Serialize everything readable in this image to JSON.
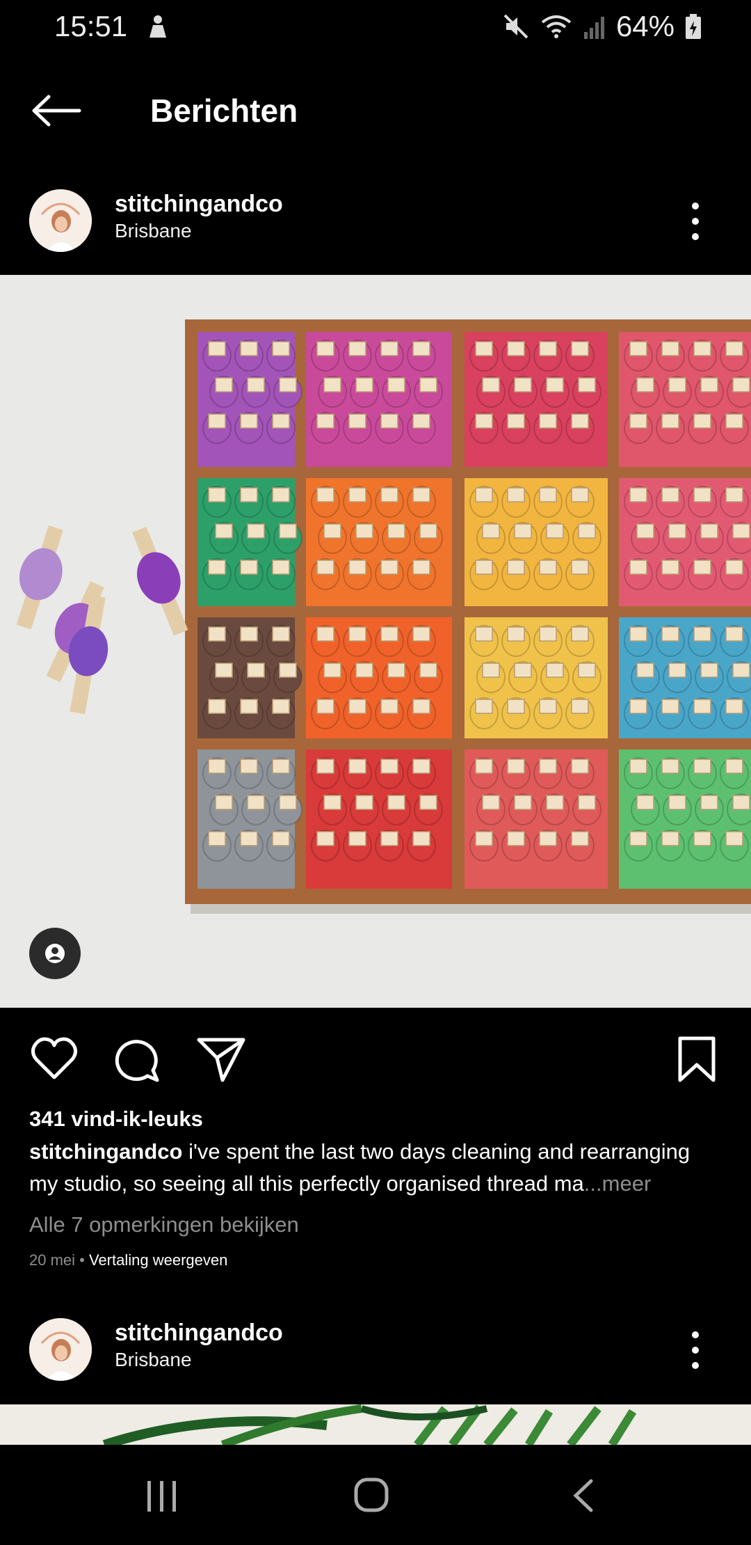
{
  "status_bar": {
    "time": "15:51",
    "battery": "64%"
  },
  "header": {
    "title": "Berichten"
  },
  "post": {
    "username": "stitchingandco",
    "location": "Brisbane",
    "likes": "341 vind-ik-leuks",
    "caption_user": "stitchingandco",
    "caption_text": " i've spent the last two days cleaning and rearranging my studio, so seeing all this perfectly organised thread ma",
    "caption_more": "...meer",
    "comments_link": "Alle 7 opmerkingen bekijken",
    "date": "20 mei",
    "separator": " • ",
    "translate": "Vertaling weergeven"
  },
  "next_post": {
    "username": "stitchingandco",
    "location": "Brisbane"
  },
  "icons": {
    "back": "arrow-left-icon",
    "more": "more-vertical-icon",
    "like": "heart-icon",
    "comment": "comment-icon",
    "share": "send-icon",
    "save": "bookmark-icon",
    "tag": "user-tag-icon",
    "nav_recents": "recents-icon",
    "nav_home": "home-icon",
    "nav_back": "nav-back-icon"
  }
}
